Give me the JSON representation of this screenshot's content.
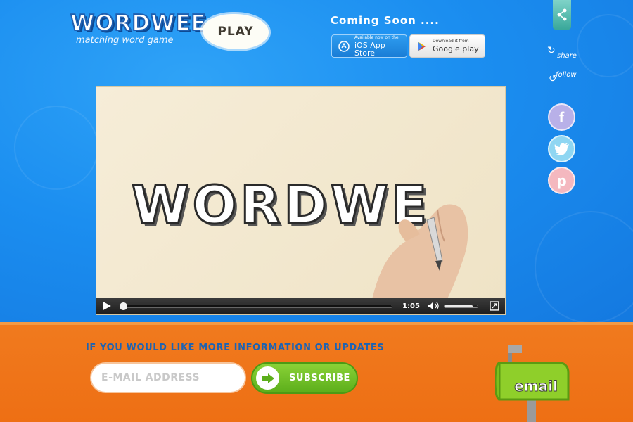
{
  "header": {
    "logo_text": "WORDWEE",
    "tagline": "matching word game",
    "play_label": "PLAY",
    "coming_soon": "Coming Soon ....",
    "ios_small": "Available now on the",
    "ios_big": "iOS App Store",
    "google_small": "Download it from",
    "google_big": "Google play"
  },
  "sidebar": {
    "share_label": "share",
    "follow_label": "follow",
    "social": [
      {
        "icon": "facebook-icon",
        "glyph": "f"
      },
      {
        "icon": "twitter-icon",
        "glyph": "t"
      },
      {
        "icon": "pinterest-icon",
        "glyph": "p"
      }
    ]
  },
  "video": {
    "title_text": "WORDWE",
    "time": "1:05",
    "progress": 0.0,
    "volume": 0.85
  },
  "subscribe": {
    "info_text": "IF YOU WOULD LIKE MORE INFORMATION OR UPDATES",
    "email_placeholder": "E-MAIL ADDRESS",
    "button_label": "SUBSCRIBE",
    "mailbox_label": "email"
  },
  "colors": {
    "sky_blue": "#1b8ef0",
    "orange": "#ee6f14",
    "subscribe_green": "#6cbf26",
    "info_blue": "#1d63b3"
  }
}
